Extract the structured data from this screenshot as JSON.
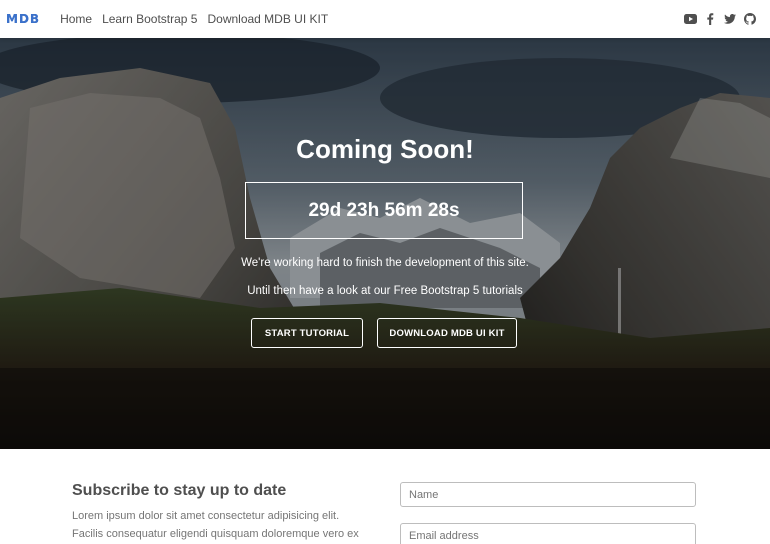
{
  "navbar": {
    "brand": "MDB",
    "links": [
      "Home",
      "Learn Bootstrap 5",
      "Download MDB UI KIT"
    ],
    "social_icons": [
      "youtube-icon",
      "facebook-icon",
      "twitter-icon",
      "github-icon"
    ]
  },
  "hero": {
    "title": "Coming Soon!",
    "countdown": "29d 23h 56m 28s",
    "text1": "We're working hard to finish the development of this site.",
    "text2": "Until then have a look at our Free Bootstrap 5 tutorials",
    "buttons": [
      "START TUTORIAL",
      "DOWNLOAD MDB UI KIT"
    ]
  },
  "subscribe": {
    "title": "Subscribe to stay up to date",
    "text": "Lorem ipsum dolor sit amet consectetur adipisicing elit. Facilis consequatur eligendi quisquam doloremque vero ex",
    "name_placeholder": "Name",
    "email_placeholder": "Email address"
  },
  "colors": {
    "brand": "#3b71ca",
    "text": "#4f4f4f",
    "hero_overlay": "rgba(0,0,0,0.25)"
  }
}
